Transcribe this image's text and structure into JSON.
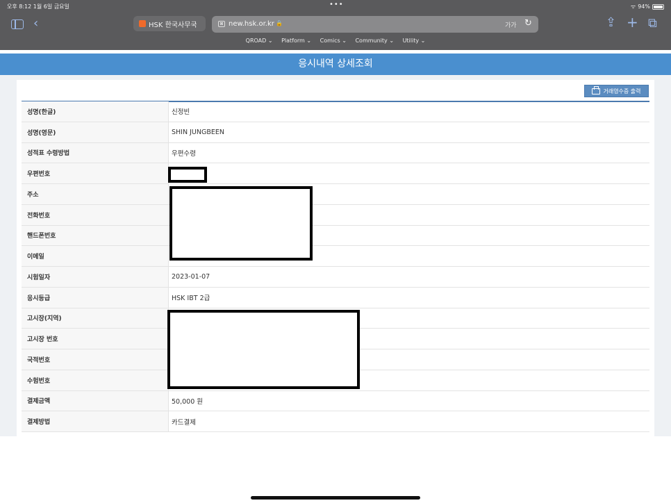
{
  "status_bar": {
    "time_date": "오후 8:12   1월 6일 금요일",
    "dots": "•••",
    "battery": "94%"
  },
  "browser": {
    "tab_title": "HSK 한국사무국",
    "url": "new.hsk.or.kr",
    "text_size_label": "가가",
    "menu": [
      "QROAD ⌄",
      "Platform ⌄",
      "Comics ⌄",
      "Community ⌄",
      "Utility ⌄"
    ]
  },
  "page": {
    "title": "응시내역 상세조회",
    "receipt_button": "거래영수증 출력",
    "rows": [
      {
        "label": "성명(한글)",
        "value": "신정빈"
      },
      {
        "label": "성명(영문)",
        "value": "SHIN JUNGBEEN"
      },
      {
        "label": "성적표 수령방법",
        "value": "우편수령"
      },
      {
        "label": "우편번호",
        "value": ""
      },
      {
        "label": "주소",
        "value": ""
      },
      {
        "label": "전화번호",
        "value": ""
      },
      {
        "label": "핸드폰번호",
        "value": ""
      },
      {
        "label": "이메일",
        "value": ""
      },
      {
        "label": "시험일자",
        "value": "2023-01-07"
      },
      {
        "label": "응시등급",
        "value": "HSK IBT 2급"
      },
      {
        "label": "고시장(지역)",
        "value": ""
      },
      {
        "label": "고시장 번호",
        "value": ""
      },
      {
        "label": "국적번호",
        "value": ""
      },
      {
        "label": "수험번호",
        "value": ""
      },
      {
        "label": "결제금액",
        "value": "50,000 원"
      },
      {
        "label": "결제방법",
        "value": "카드결제"
      }
    ]
  }
}
